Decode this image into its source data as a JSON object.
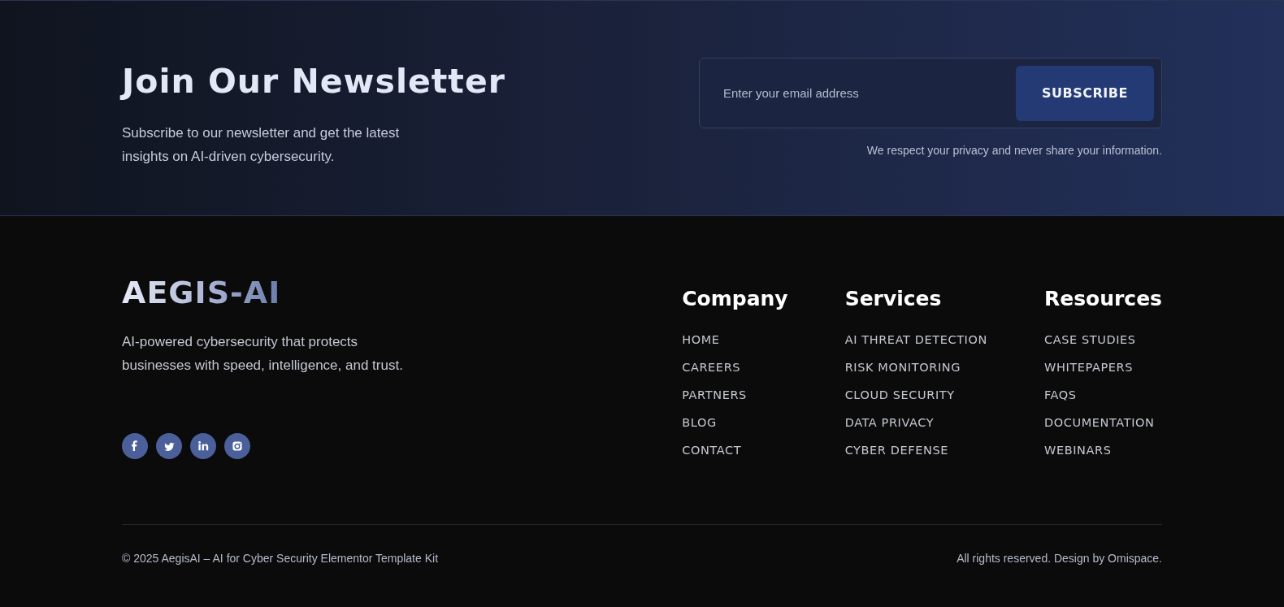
{
  "newsletter": {
    "title": "Join Our Newsletter",
    "description": "Subscribe to our newsletter and get the latest insights on AI-driven cybersecurity.",
    "email_field": {
      "placeholder": "Enter your email address"
    },
    "subscribe_button": "SUBSCRIBE",
    "privacy_note": "We respect your privacy and never share your information."
  },
  "footer": {
    "logo": "AEGIS-AI",
    "tagline": "AI-powered cybersecurity that protects businesses with speed, intelligence, and trust.",
    "social_links": [
      {
        "kind": "facebook"
      },
      {
        "kind": "twitter"
      },
      {
        "kind": "linkedin"
      },
      {
        "kind": "instagram"
      }
    ],
    "columns": [
      {
        "heading": "Company",
        "links": [
          "HOME",
          "CAREERS",
          "PARTNERS",
          "BLOG",
          "CONTACT"
        ]
      },
      {
        "heading": "Services",
        "links": [
          "AI THREAT DETECTION",
          "RISK MONITORING",
          "CLOUD SECURITY",
          "DATA PRIVACY",
          "CYBER DEFENSE"
        ]
      },
      {
        "heading": "Resources",
        "links": [
          "CASE STUDIES",
          "WHITEPAPERS",
          "FAQS",
          "DOCUMENTATION",
          "WEBINARS"
        ]
      }
    ]
  },
  "bottom_bar": {
    "copyright": "© 2025 AegisAI – AI for Cyber Security Elementor Template Kit",
    "credit": "All rights reserved. Design by Omispace."
  }
}
